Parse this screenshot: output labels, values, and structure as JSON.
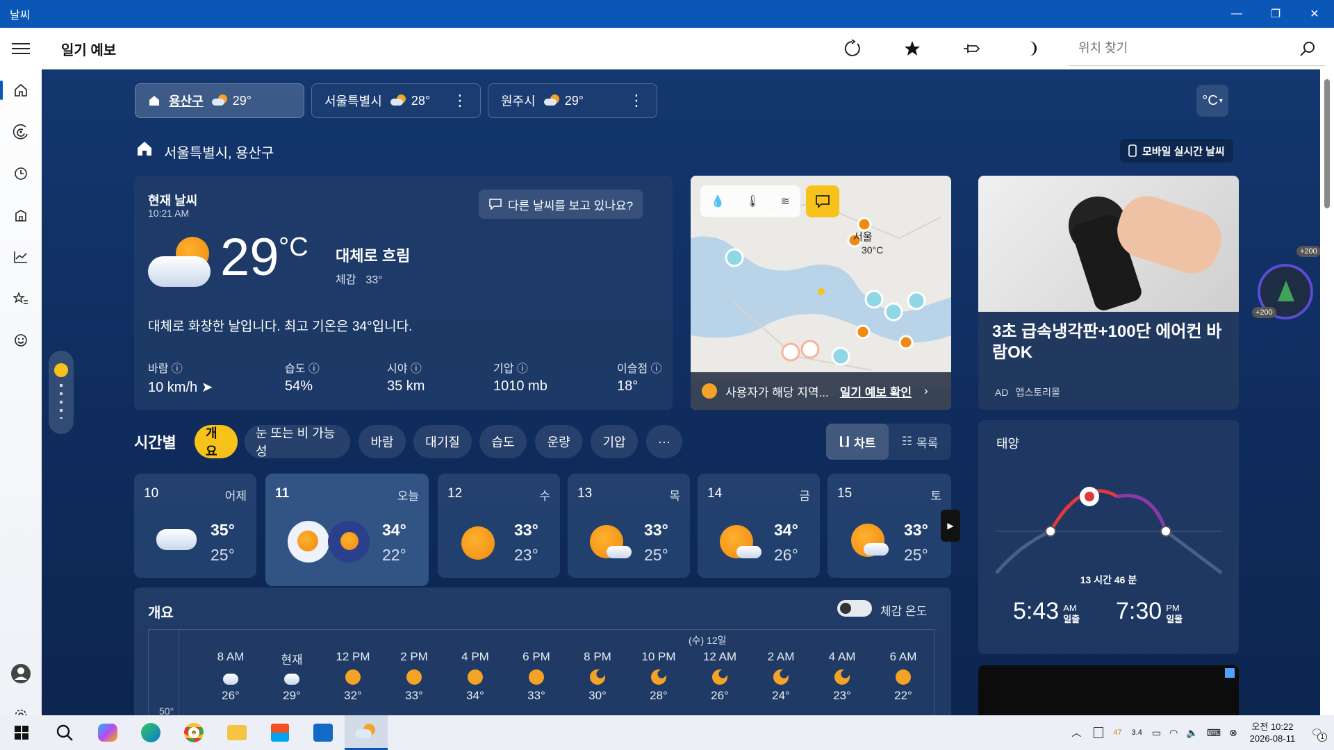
{
  "window": {
    "title": "날씨",
    "min_icon": "minimize-icon",
    "max_icon": "restore-icon",
    "close_icon": "close-icon"
  },
  "topbar": {
    "app_title": "일기 예보",
    "search_placeholder": "위치 찾기"
  },
  "locations": [
    {
      "name": "용산구",
      "temp": "29°"
    },
    {
      "name": "서울특별시",
      "temp": "28°"
    },
    {
      "name": "원주시",
      "temp": "29°"
    }
  ],
  "unit_button": "°C",
  "location_heading": "서울특별시, 용산구",
  "mobile_button": "모바일 실시간 날씨",
  "current": {
    "title": "현재 날씨",
    "time": "10:21 AM",
    "feedback_button": "다른 날씨를 보고 있나요?",
    "temp": "29",
    "unit": "°C",
    "condition": "대체로 흐림",
    "feels_label": "체감",
    "feels_value": "33°",
    "summary": "대체로 화창한 날입니다. 최고 기온은 34°입니다.",
    "stats": [
      {
        "label": "바람",
        "value": "10 km/h"
      },
      {
        "label": "습도",
        "value": "54%"
      },
      {
        "label": "시야",
        "value": "35 km"
      },
      {
        "label": "기압",
        "value": "1010 mb"
      },
      {
        "label": "이슬점",
        "value": "18°"
      }
    ]
  },
  "map": {
    "city_label": "서울",
    "city_temp": "30°C",
    "footer_text": "사용자가 해당 지역...",
    "footer_link": "일기 예보 확인"
  },
  "ad": {
    "headline": "3초 급속냉각판+100단 에어컨 바람OK",
    "ad_label": "AD",
    "advertiser": "앱스토리몰",
    "badge1": "+200",
    "badge2": "+200"
  },
  "hourly": {
    "title": "시간별",
    "chips": [
      "개요",
      "눈 또는 비 가능성",
      "바람",
      "대기질",
      "습도",
      "운량",
      "기압",
      "···"
    ],
    "view_chart": "차트",
    "view_list": "목록"
  },
  "days": [
    {
      "date": "10",
      "weekday": "어제",
      "hi": "35°",
      "lo": "25°"
    },
    {
      "date": "11",
      "weekday": "오늘",
      "hi": "34°",
      "lo": "22°"
    },
    {
      "date": "12",
      "weekday": "수",
      "hi": "33°",
      "lo": "23°"
    },
    {
      "date": "13",
      "weekday": "목",
      "hi": "33°",
      "lo": "25°"
    },
    {
      "date": "14",
      "weekday": "금",
      "hi": "34°",
      "lo": "26°"
    },
    {
      "date": "15",
      "weekday": "토",
      "hi": "33°",
      "lo": "25°"
    }
  ],
  "overview": {
    "title": "개요",
    "toggle_label": "체감 온도",
    "day_marker": "(수) 12일",
    "y_label": "50°",
    "hours": [
      "8 AM",
      "현재",
      "12 PM",
      "2 PM",
      "4 PM",
      "6 PM",
      "8 PM",
      "10 PM",
      "12 AM",
      "2 AM",
      "4 AM",
      "6 AM"
    ],
    "temps": [
      "26°",
      "29°",
      "32°",
      "33°",
      "34°",
      "33°",
      "30°",
      "28°",
      "26°",
      "24°",
      "23°",
      "22°"
    ]
  },
  "sun": {
    "title": "태양",
    "daylight": "13 시간 46 분",
    "sunrise_time": "5:43",
    "sunrise_ampm": "AM",
    "sunrise_label": "일출",
    "sunset_time": "7:30",
    "sunset_ampm": "PM",
    "sunset_label": "일몰"
  },
  "taskbar": {
    "clock_time": "오전 10:22",
    "clock_date": "2026-08-11",
    "tray_num1": "47",
    "tray_num2": "3.4",
    "notif_count": "1"
  },
  "colors": {
    "accent": "#0a57b8",
    "chip_active": "#f7c21a",
    "sun_orange": "#f4a326"
  }
}
